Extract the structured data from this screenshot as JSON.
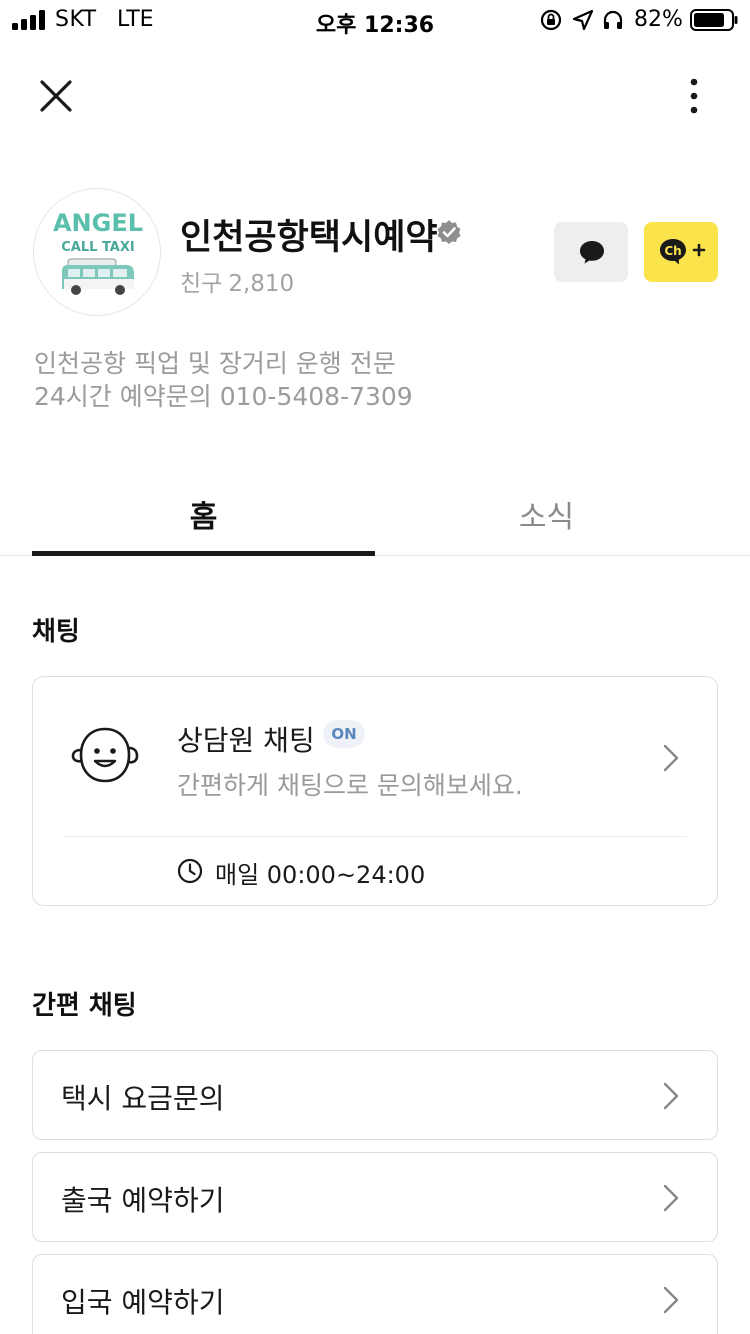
{
  "status_bar": {
    "carrier": "SKT",
    "network": "LTE",
    "time": "오후 12:36",
    "battery": "82%",
    "icons": [
      "signal-icon",
      "rotation-lock-icon",
      "location-icon",
      "headphones-icon",
      "battery-icon"
    ]
  },
  "header": {
    "close_icon": "close-icon",
    "more_icon": "more-vertical-icon"
  },
  "profile": {
    "logo_text_1": "ANGEL",
    "logo_text_2": "CALL TAXI",
    "name": "인천공항택시예약",
    "friends_label": "친구",
    "friends_count": "2,810",
    "description_line_1": "인천공항 픽업 및 장거리 운행 전문",
    "description_line_2": "24시간 예약문의 010-5408-7309",
    "chat_button_icon": "chat-bubble-icon",
    "add_channel_icon": "channel-plus-icon"
  },
  "tabs": {
    "home": "홈",
    "news": "소식"
  },
  "chat_section": {
    "title": "채팅",
    "card_title": "상담원 채팅",
    "badge": "ON",
    "subtitle": "간편하게 채팅으로 문의해보세요.",
    "hours": "매일 00:00~24:00"
  },
  "quick_section": {
    "title": "간편 채팅",
    "items": [
      {
        "label": "택시 요금문의"
      },
      {
        "label": "출국 예약하기"
      },
      {
        "label": "입국 예약하기"
      }
    ]
  },
  "colors": {
    "accent_yellow": "#fae34b",
    "badge_blue": "#5b86bd",
    "logo_teal": "#5bbfad",
    "tab_indicator": "#1a1a1a"
  }
}
